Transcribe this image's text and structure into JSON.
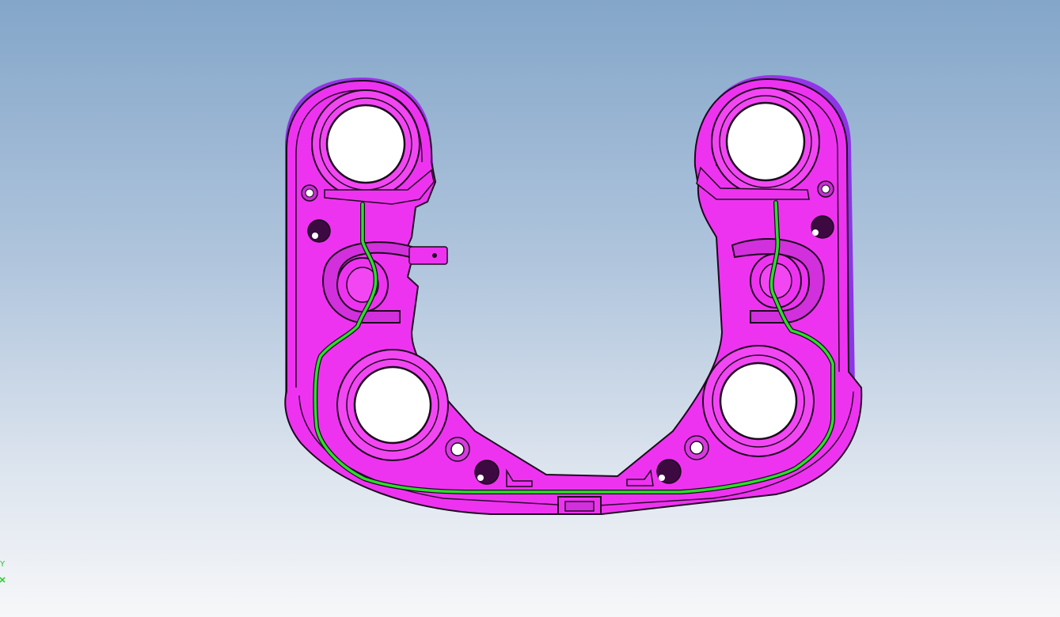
{
  "viewport": {
    "background_top": "#84a6c9",
    "background_bottom": "#f6f7f9"
  },
  "model": {
    "part_color": "#ee33f0",
    "part_shadow_color": "#9a3ae8",
    "edge_color": "#1c0a1e",
    "wire_color": "#2cdd2c"
  },
  "triad": {
    "y_label": "Y",
    "color": "#22cc22"
  }
}
